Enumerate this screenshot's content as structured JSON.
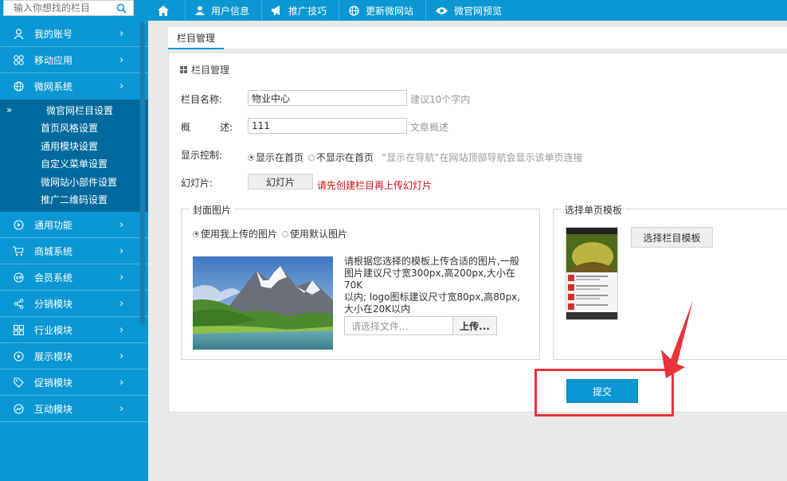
{
  "search": {
    "placeholder": "输入你想找的栏目"
  },
  "topnav": [
    {
      "label": ""
    },
    {
      "label": "用户信息"
    },
    {
      "label": "推广技巧"
    },
    {
      "label": "更新微网站"
    },
    {
      "label": "微官网预览"
    }
  ],
  "sidebar": {
    "items_top": [
      {
        "label": "我的账号"
      },
      {
        "label": "移动应用"
      },
      {
        "label": "微网系统"
      }
    ],
    "submenu": [
      {
        "label": "微官网栏目设置",
        "active": true,
        "marker": "»"
      },
      {
        "label": "首页风格设置"
      },
      {
        "label": "通用模块设置"
      },
      {
        "label": "自定义菜单设置"
      },
      {
        "label": "微网站小部件设置"
      },
      {
        "label": "推广二维码设置"
      }
    ],
    "items_bottom": [
      {
        "label": "通用功能"
      },
      {
        "label": "商城系统"
      },
      {
        "label": "会员系统"
      },
      {
        "label": "分销模块"
      },
      {
        "label": "行业模块"
      },
      {
        "label": "展示模块"
      },
      {
        "label": "促销模块"
      },
      {
        "label": "互动模块"
      }
    ],
    "chevron": "›"
  },
  "tab": {
    "label": "栏目管理"
  },
  "form": {
    "section_title": "栏目管理",
    "name_label": "栏目名称:",
    "name_value": "物业中心",
    "name_hint": "建议10个字内",
    "desc_label_a": "概",
    "desc_label_b": "述:",
    "desc_value": "111",
    "desc_hint": "文章概述",
    "display_label": "显示控制:",
    "display_opt1": "显示在首页",
    "display_opt2": "不显示在首页",
    "display_hint": "“显示在导航”在网站顶部导航会显示该单页连接",
    "slide_label": "幻灯片:",
    "slide_button": "幻灯片",
    "slide_warn": "请先创建栏目再上传幻灯片",
    "cover": {
      "legend": "封面图片",
      "opt1": "使用我上传的图片",
      "opt2": "使用默认图片",
      "desc_line1": "请根据您选择的模板上传合适的图片,一般",
      "desc_line2": "图片建议尺寸宽300px,高200px,大小在70K",
      "desc_line3": "以内; logo图标建议尺寸宽80px,高80px,",
      "desc_line4": "大小在20K以内",
      "file_placeholder": "请选择文件...",
      "upload_button": "上传..."
    },
    "template": {
      "legend": "选择单页模板",
      "button": "选择栏目模板"
    },
    "submit_button": "提交"
  },
  "colors": {
    "brand": "#0b97d3",
    "sidebar_sub": "#006a9e",
    "warn": "#d01010",
    "annotation": "#e8343a"
  }
}
